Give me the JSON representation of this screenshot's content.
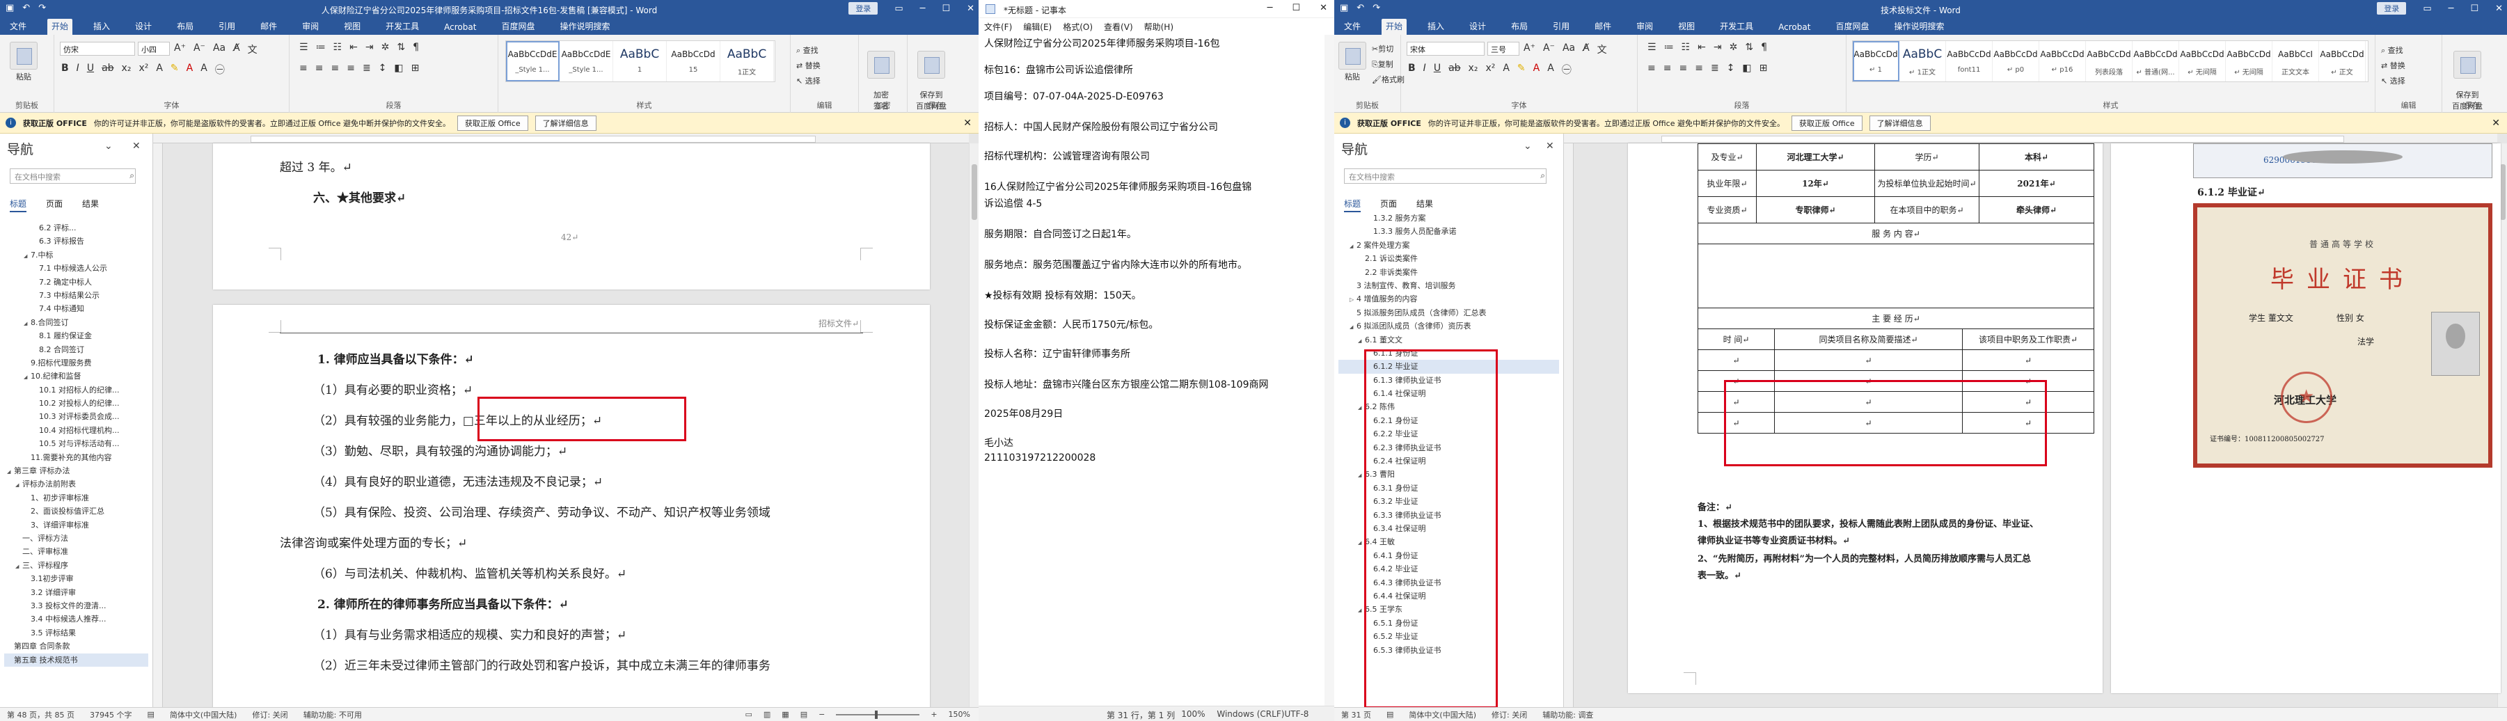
{
  "left_word": {
    "title": "人保财险辽宁省分公司2025年律师服务采购项目-招标文件16包-发售稿 [兼容模式] - Word",
    "login": "登录",
    "share": "共享",
    "menu": [
      "文件",
      "开始",
      "插入",
      "设计",
      "布局",
      "引用",
      "邮件",
      "审阅",
      "视图",
      "开发工具",
      "Acrobat",
      "百度网盘",
      "操作说明搜索"
    ],
    "ribbon": {
      "paste": "粘贴",
      "clipboard_label": "剪贴板",
      "font_name": "仿宋",
      "font_size": "小四",
      "font_label": "字体",
      "para_label": "段落",
      "style_label": "样式",
      "styles": [
        {
          "preview": "AaBbCcDdE",
          "name": "_Style 1..."
        },
        {
          "preview": "AaBbCcDdE",
          "name": "_Style 1..."
        },
        {
          "preview": "AaBbC",
          "name": "1"
        },
        {
          "preview": "AaBbCcDd",
          "name": "15"
        },
        {
          "preview": "AaBbC",
          "name": "1正文"
        }
      ],
      "find": "查找",
      "replace": "替换",
      "select": "选择",
      "edit_label": "编辑",
      "bdpdf": "加密\n签名",
      "bdpdf_label": "加密",
      "save_baidu": "保存到\n百度网盘",
      "save_label": "保存"
    },
    "info": {
      "tag": "获取正版 OFFICE",
      "text": "你的许可证并非正版，你可能是盗版软件的受害者。立即通过正版 Office 避免中断并保护你的文件安全。",
      "btn1": "获取正版 Office",
      "btn2": "了解详细信息"
    },
    "nav": {
      "title": "导航",
      "search": "在文档中搜索",
      "tabs": [
        "标题",
        "页面",
        "结果"
      ],
      "items": [
        {
          "t": "6.2 评标...",
          "l": 3,
          "k": ""
        },
        {
          "t": "6.3 评标报告",
          "l": 3,
          "k": ""
        },
        {
          "t": "7.中标",
          "l": 2,
          "k": "exp"
        },
        {
          "t": "7.1 中标候选人公示",
          "l": 3,
          "k": ""
        },
        {
          "t": "7.2 确定中标人",
          "l": 3,
          "k": ""
        },
        {
          "t": "7.3 中标结果公示",
          "l": 3,
          "k": ""
        },
        {
          "t": "7.4 中标通知",
          "l": 3,
          "k": ""
        },
        {
          "t": "8.合同签订",
          "l": 2,
          "k": "exp"
        },
        {
          "t": "8.1 履约保证金",
          "l": 3,
          "k": ""
        },
        {
          "t": "8.2 合同签订",
          "l": 3,
          "k": ""
        },
        {
          "t": "9.招标代理服务费",
          "l": 2,
          "k": ""
        },
        {
          "t": "10.纪律和监督",
          "l": 2,
          "k": "exp"
        },
        {
          "t": "10.1 对招标人的纪律...",
          "l": 3,
          "k": ""
        },
        {
          "t": "10.2 对投标人的纪律...",
          "l": 3,
          "k": ""
        },
        {
          "t": "10.3 对评标委员会成...",
          "l": 3,
          "k": ""
        },
        {
          "t": "10.4 对招标代理机构...",
          "l": 3,
          "k": ""
        },
        {
          "t": "10.5 对与评标活动有...",
          "l": 3,
          "k": ""
        },
        {
          "t": "11.需要补充的其他内容",
          "l": 2,
          "k": ""
        },
        {
          "t": "第三章 评标办法",
          "l": 0,
          "k": "exp"
        },
        {
          "t": "评标办法前附表",
          "l": 1,
          "k": "exp"
        },
        {
          "t": "1、初步评审标准",
          "l": 2,
          "k": ""
        },
        {
          "t": "2、面谈投标值评汇总",
          "l": 2,
          "k": ""
        },
        {
          "t": "3、详细评审标准",
          "l": 2,
          "k": ""
        },
        {
          "t": "一、评标方法",
          "l": 1,
          "k": ""
        },
        {
          "t": "二、评审标准",
          "l": 1,
          "k": ""
        },
        {
          "t": "三、评标程序",
          "l": 1,
          "k": "exp"
        },
        {
          "t": "3.1初步评审",
          "l": 2,
          "k": ""
        },
        {
          "t": "3.2 详细评审",
          "l": 2,
          "k": ""
        },
        {
          "t": "3.3 投标文件的澄清...",
          "l": 2,
          "k": ""
        },
        {
          "t": "3.4 中标候选人推荐...",
          "l": 2,
          "k": ""
        },
        {
          "t": "3.5 评标结果",
          "l": 2,
          "k": ""
        },
        {
          "t": "第四章 合同条款",
          "l": 0,
          "k": ""
        },
        {
          "t": "第五章 技术规范书",
          "l": 0,
          "k": "sel"
        }
      ]
    },
    "page1_lines": [
      "超过 3 年。↵",
      "六、★其他要求↵",
      "42↵"
    ],
    "header_right": "招标文件↵",
    "page2_lines": [
      {
        "t": "1. 律师应当具备以下条件：↵",
        "b": true
      },
      {
        "t": "（1）具有必要的职业资格；↵"
      },
      {
        "t": "（2）具有较强的业务能力，□三年以上的从业经历；↵"
      },
      {
        "t": "（3）勤勉、尽职，具有较强的沟通协调能力；↵"
      },
      {
        "t": "（4）具有良好的职业道德，无违法违规及不良记录；↵"
      },
      {
        "t": "（5）具有保险、投资、公司治理、存续资产、劳动争议、不动产、知识产权等业务领域"
      },
      {
        "t": "法律咨询或案件处理方面的专长；↵"
      },
      {
        "t": "（6）与司法机关、仲裁机构、监管机关等机构关系良好。↵"
      },
      {
        "t": "2. 律师所在的律师事务所应当具备以下条件：↵",
        "b": true
      },
      {
        "t": "（1）具有与业务需求相适应的规模、实力和良好的声誉；↵"
      },
      {
        "t": "（2）近三年未受过律师主管部门的行政处罚和客户投诉，其中成立未满三年的律师事务"
      }
    ],
    "status": {
      "page": "第 48 页，共 85 页",
      "words": "37945 个字",
      "lang": "简体中文(中国大陆)",
      "mode": "修订: 关闭",
      "access": "辅助功能: 不可用",
      "zoom": "150%"
    }
  },
  "notepad": {
    "title": "*无标题 - 记事本",
    "menu": [
      "文件(F)",
      "编辑(E)",
      "格式(O)",
      "查看(V)",
      "帮助(H)"
    ],
    "lines": [
      "人保财险辽宁省分公司2025年律师服务采购项目-16包",
      "标包16：盘锦市公司诉讼追偿律所",
      "项目编号：07-07-04A-2025-D-E09763",
      "招标人：中国人民财产保险股份有限公司辽宁省分公司",
      "招标代理机构：公诚管理咨询有限公司",
      "16人保财险辽宁省分公司2025年律师服务采购项目-16包盘锦",
      "诉讼追偿    4-5",
      "服务期限：自合同签订之日起1年。",
      "服务地点：服务范围覆盖辽宁省内除大连市以外的所有地市。",
      "★投标有效期        投标有效期：150天。",
      "投标保证金金额：人民币1750元/标包。",
      "投标人名称：辽宁宙轩律师事务所",
      "投标人地址：盘锦市兴隆台区东方银座公馆二期东侧108-109商网",
      "2025年08月29日",
      "毛小达",
      "211103197212200028"
    ],
    "status": {
      "pos": "第 31 行，第 1 列",
      "zoom": "100%",
      "eol": "Windows (CRLF)",
      "enc": "UTF-8"
    }
  },
  "right_word": {
    "title": "技术投标文件 - Word",
    "login": "登录",
    "share": "共享",
    "menu": [
      "文件",
      "开始",
      "插入",
      "设计",
      "布局",
      "引用",
      "邮件",
      "审阅",
      "视图",
      "开发工具",
      "Acrobat",
      "百度网盘",
      "操作说明搜索"
    ],
    "ribbon": {
      "paste": "粘贴",
      "cut": "剪切",
      "copy": "复制",
      "format_painter": "格式刷",
      "clipboard_label": "剪贴板",
      "font_name": "宋体",
      "font_size": "三号",
      "font_label": "字体",
      "para_label": "段落",
      "style_label": "样式",
      "styles": [
        {
          "preview": "AaBbCcDd",
          "name": "↵ 1"
        },
        {
          "preview": "AaBbC",
          "name": "↵ 1正文"
        },
        {
          "preview": "AaBbCcDd",
          "name": "font11"
        },
        {
          "preview": "AaBbCcDd",
          "name": "↵ p0"
        },
        {
          "preview": "AaBbCcDd",
          "name": "↵ p16"
        },
        {
          "preview": "AaBbCcDd",
          "name": "列表段落"
        },
        {
          "preview": "AaBbCcDd",
          "name": "↵ 普通(网..."
        },
        {
          "preview": "AaBbCcDd",
          "name": "↵ 无间隔"
        },
        {
          "preview": "AaBbCcDd",
          "name": "↵ 无间隔"
        },
        {
          "preview": "AaBbCcI",
          "name": "正文文本"
        },
        {
          "preview": "AaBbCcDd",
          "name": "↵ 正文"
        }
      ],
      "find": "查找",
      "replace": "替换",
      "select": "选择",
      "edit_label": "编辑",
      "save_baidu": "保存到\n百度网盘",
      "save_label": "保存"
    },
    "info": {
      "tag": "获取正版 OFFICE",
      "text": "你的许可证并非正版，你可能是盗版软件的受害者。立即通过正版 Office 避免中断并保护你的文件安全。",
      "btn1": "获取正版 Office",
      "btn2": "了解详细信息"
    },
    "nav": {
      "title": "导航",
      "search": "在文档中搜索",
      "tabs": [
        "标题",
        "页面",
        "结果"
      ],
      "items": [
        {
          "t": "1.3.2 服务方案",
          "l": 3,
          "k": ""
        },
        {
          "t": "1.3.3 服务人员配备承诺",
          "l": 3,
          "k": ""
        },
        {
          "t": "2 案件处理方案",
          "l": 1,
          "k": "exp"
        },
        {
          "t": "2.1 诉讼类案件",
          "l": 2,
          "k": ""
        },
        {
          "t": "2.2 非诉类案件",
          "l": 2,
          "k": ""
        },
        {
          "t": "3 法制宣传、教育、培训服务",
          "l": 1,
          "k": ""
        },
        {
          "t": "4 增值服务的内容",
          "l": 1,
          "k": "col"
        },
        {
          "t": "5 拟派服务团队成员（含律师）汇总表",
          "l": 1,
          "k": ""
        },
        {
          "t": "6 拟派团队成员（含律师）资历表",
          "l": 1,
          "k": "exp"
        },
        {
          "t": "6.1 董文文",
          "l": 2,
          "k": "exp"
        },
        {
          "t": "6.1.1 身份证",
          "l": 3,
          "k": ""
        },
        {
          "t": "6.1.2 毕业证",
          "l": 3,
          "k": "sel"
        },
        {
          "t": "6.1.3 律师执业证书",
          "l": 3,
          "k": ""
        },
        {
          "t": "6.1.4 社保证明",
          "l": 3,
          "k": ""
        },
        {
          "t": "6.2 陈伟",
          "l": 2,
          "k": "exp"
        },
        {
          "t": "6.2.1 身份证",
          "l": 3,
          "k": ""
        },
        {
          "t": "6.2.2 毕业证",
          "l": 3,
          "k": ""
        },
        {
          "t": "6.2.3 律师执业证书",
          "l": 3,
          "k": ""
        },
        {
          "t": "6.2.4 社保证明",
          "l": 3,
          "k": ""
        },
        {
          "t": "6.3 曹阳",
          "l": 2,
          "k": "exp"
        },
        {
          "t": "6.3.1 身份证",
          "l": 3,
          "k": ""
        },
        {
          "t": "6.3.2 毕业证",
          "l": 3,
          "k": ""
        },
        {
          "t": "6.3.3 律师执业证书",
          "l": 3,
          "k": ""
        },
        {
          "t": "6.3.4 社保证明",
          "l": 3,
          "k": ""
        },
        {
          "t": "6.4 王敏",
          "l": 2,
          "k": "exp"
        },
        {
          "t": "6.4.1 身份证",
          "l": 3,
          "k": ""
        },
        {
          "t": "6.4.2 毕业证",
          "l": 3,
          "k": ""
        },
        {
          "t": "6.4.3 律师执业证书",
          "l": 3,
          "k": ""
        },
        {
          "t": "6.4.4 社保证明",
          "l": 3,
          "k": ""
        },
        {
          "t": "6.5 王学东",
          "l": 2,
          "k": "exp"
        },
        {
          "t": "6.5.1 身份证",
          "l": 3,
          "k": ""
        },
        {
          "t": "6.5.2 毕业证",
          "l": 3,
          "k": ""
        },
        {
          "t": "6.5.3 律师执业证书",
          "l": 3,
          "k": ""
        }
      ]
    },
    "table": {
      "r1": [
        "及专业↵",
        "河北理工大学↵",
        "学历↵",
        "本科↵"
      ],
      "r2": [
        "执业年限↵",
        "12年↵",
        "为投标单位执业起始时间↵",
        "2021年↵"
      ],
      "r3": [
        "专业资质↵",
        "专职律师↵",
        "在本项目中的职务↵",
        "牵头律师↵"
      ],
      "r4": "服  务  内  容↵",
      "r5": "主 要 经 历↵",
      "r6": [
        "时 间↵",
        "同类项目名称及简要描述↵",
        "该项目中职务及工作职责↵"
      ]
    },
    "notes": {
      "title": "备注：↵",
      "n1": "1、根据技术规范书中的团队要求，投标人需随此表附上团队成员的身份证、毕业证、",
      "n1b": "律师执业证书等专业资质证书材料。↵",
      "n2": "2、“先附简历，再附材料”为一个人员的完整材料，人员简历排放顺序需与人员汇总",
      "n2b": "表一致。↵"
    },
    "cert": {
      "heading": "6.1.2 毕业证↵",
      "top_number": "629006198608157067",
      "title": "毕业证书",
      "school_cn": "普通高等学校",
      "student": "学生 董文文",
      "gender": "性别 女",
      "major": "法学",
      "school": "河北理工大学",
      "cert_no": "证书编号：100811200805002727"
    },
    "status": {
      "page": "第 31 页",
      "lang": "简体中文(中国大陆)",
      "mode": "修订: 关闭",
      "access": "辅助功能: 调查"
    }
  },
  "colors": {
    "word_blue": "#2b579a",
    "info_bg": "#fff4ce",
    "highlight_red": "#d9001b"
  }
}
